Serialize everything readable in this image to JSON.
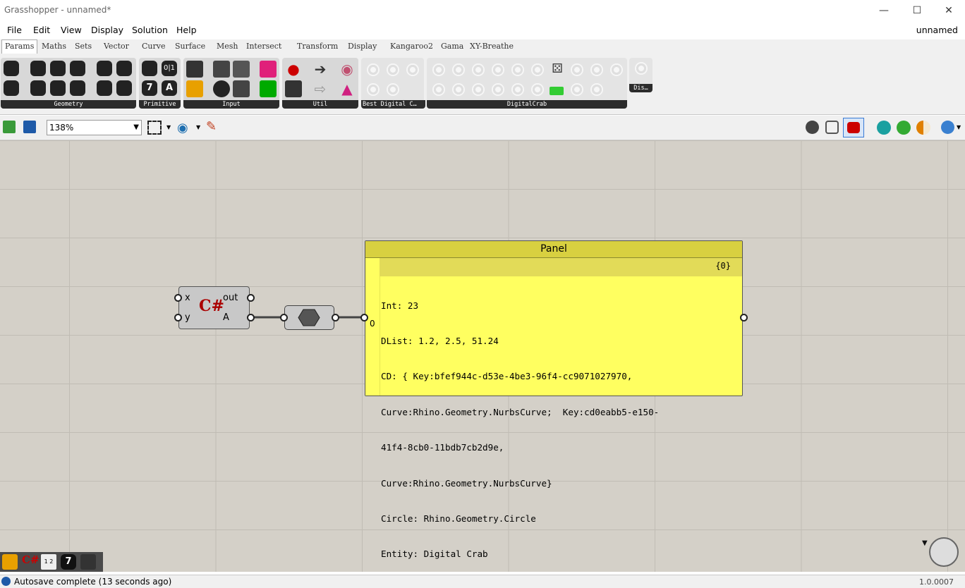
{
  "window": {
    "title": "Grasshopper - unnamed*",
    "minimize": "—",
    "maximize": "☐",
    "close": "✕"
  },
  "menu": {
    "items": [
      "File",
      "Edit",
      "View",
      "Display",
      "Solution",
      "Help"
    ],
    "document": "unnamed"
  },
  "tabs": [
    "Params",
    "Maths",
    "Sets",
    "Vector",
    "Curve",
    "Surface",
    "Mesh",
    "Intersect",
    "Transform",
    "Display",
    "Kangaroo2",
    "Gama",
    "XY-Breathe"
  ],
  "active_tab": "Params",
  "ribbon": {
    "groups": [
      "Geometry",
      "Primitive",
      "Input",
      "Util",
      "Best Digital C…",
      "DigitalCrab",
      "Dis…"
    ],
    "primitive_icons": [
      "0|1",
      "7",
      "A"
    ]
  },
  "toolbar": {
    "zoom": "138%"
  },
  "canvas": {
    "csharp": {
      "inputs": [
        "x",
        "y"
      ],
      "outputs": [
        "out",
        "A"
      ],
      "logo": "C#"
    },
    "panel": {
      "title": "Panel",
      "path": "{0}",
      "index": "0",
      "lines": [
        "Int: 23",
        "DList: 1.2, 2.5, 51.24",
        "CD: { Key:bfef944c-d53e-4be3-96f4-cc9071027970,",
        "Curve:Rhino.Geometry.NurbsCurve;  Key:cd0eabb5-e150-",
        "41f4-8cb0-11bdb7cb2d9e,",
        "Curve:Rhino.Geometry.NurbsCurve}",
        "Circle: Rhino.Geometry.Circle",
        "Entity: Digital Crab"
      ]
    }
  },
  "recent_icons": [
    "graph-icon",
    "csharp-icon",
    "numbers-icon",
    "integer-icon",
    "internalise-icon"
  ],
  "recent": {
    "integer_label": "7",
    "numbers_label": "1 2"
  },
  "status": {
    "message": "Autosave complete (13 seconds ago)",
    "version": "1.0.0007"
  }
}
